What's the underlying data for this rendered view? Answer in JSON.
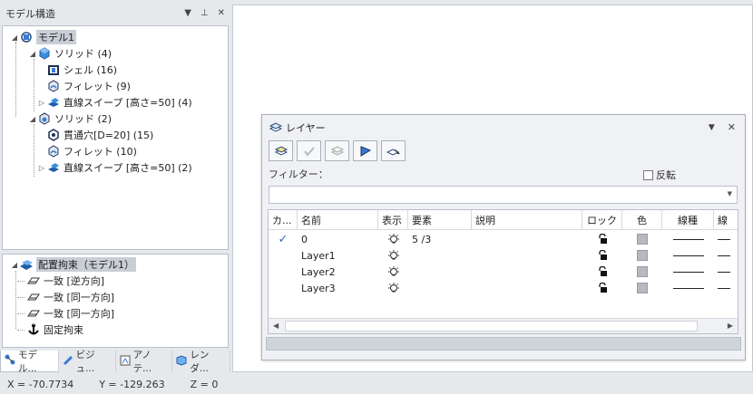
{
  "model_panel": {
    "title": "モデル構造",
    "tree": [
      {
        "label": "モデル1"
      },
      {
        "label": "ソリッド (4)"
      },
      {
        "label": "シェル (16)"
      },
      {
        "label": "フィレット (9)"
      },
      {
        "label": "直線スイープ [高さ=50] (4)"
      },
      {
        "label": "ソリッド (2)"
      },
      {
        "label": "貫通穴[D=20] (15)"
      },
      {
        "label": "フィレット (10)"
      },
      {
        "label": "直線スイープ [高さ=50] (2)"
      }
    ]
  },
  "constraint_panel": {
    "tree": [
      {
        "label": "配置拘束（モデル1）"
      },
      {
        "label": "一致 [逆方向]"
      },
      {
        "label": "一致 [同一方向]"
      },
      {
        "label": "一致 [同一方向]"
      },
      {
        "label": "固定拘束"
      }
    ]
  },
  "bottom_tabs": [
    {
      "label": "モデル..."
    },
    {
      "label": "ビジュ..."
    },
    {
      "label": "アノテ..."
    },
    {
      "label": "レンダ..."
    }
  ],
  "layer_dialog": {
    "title": "レイヤー",
    "filter_label": "フィルター：",
    "invert_label": "反転",
    "filter_value": "",
    "columns": [
      "カ...",
      "名前",
      "表示",
      "要素",
      "説明",
      "ロック",
      "色",
      "線種",
      "線"
    ],
    "rows": [
      {
        "current": "✓",
        "name": "0",
        "elements": "5 /3",
        "description": ""
      },
      {
        "current": "",
        "name": "Layer1",
        "elements": "",
        "description": ""
      },
      {
        "current": "",
        "name": "Layer2",
        "elements": "",
        "description": ""
      },
      {
        "current": "",
        "name": "Layer3",
        "elements": "",
        "description": ""
      }
    ]
  },
  "status": {
    "x": "X = -70.7734",
    "y": "Y = -129.263",
    "z": "Z = 0"
  }
}
